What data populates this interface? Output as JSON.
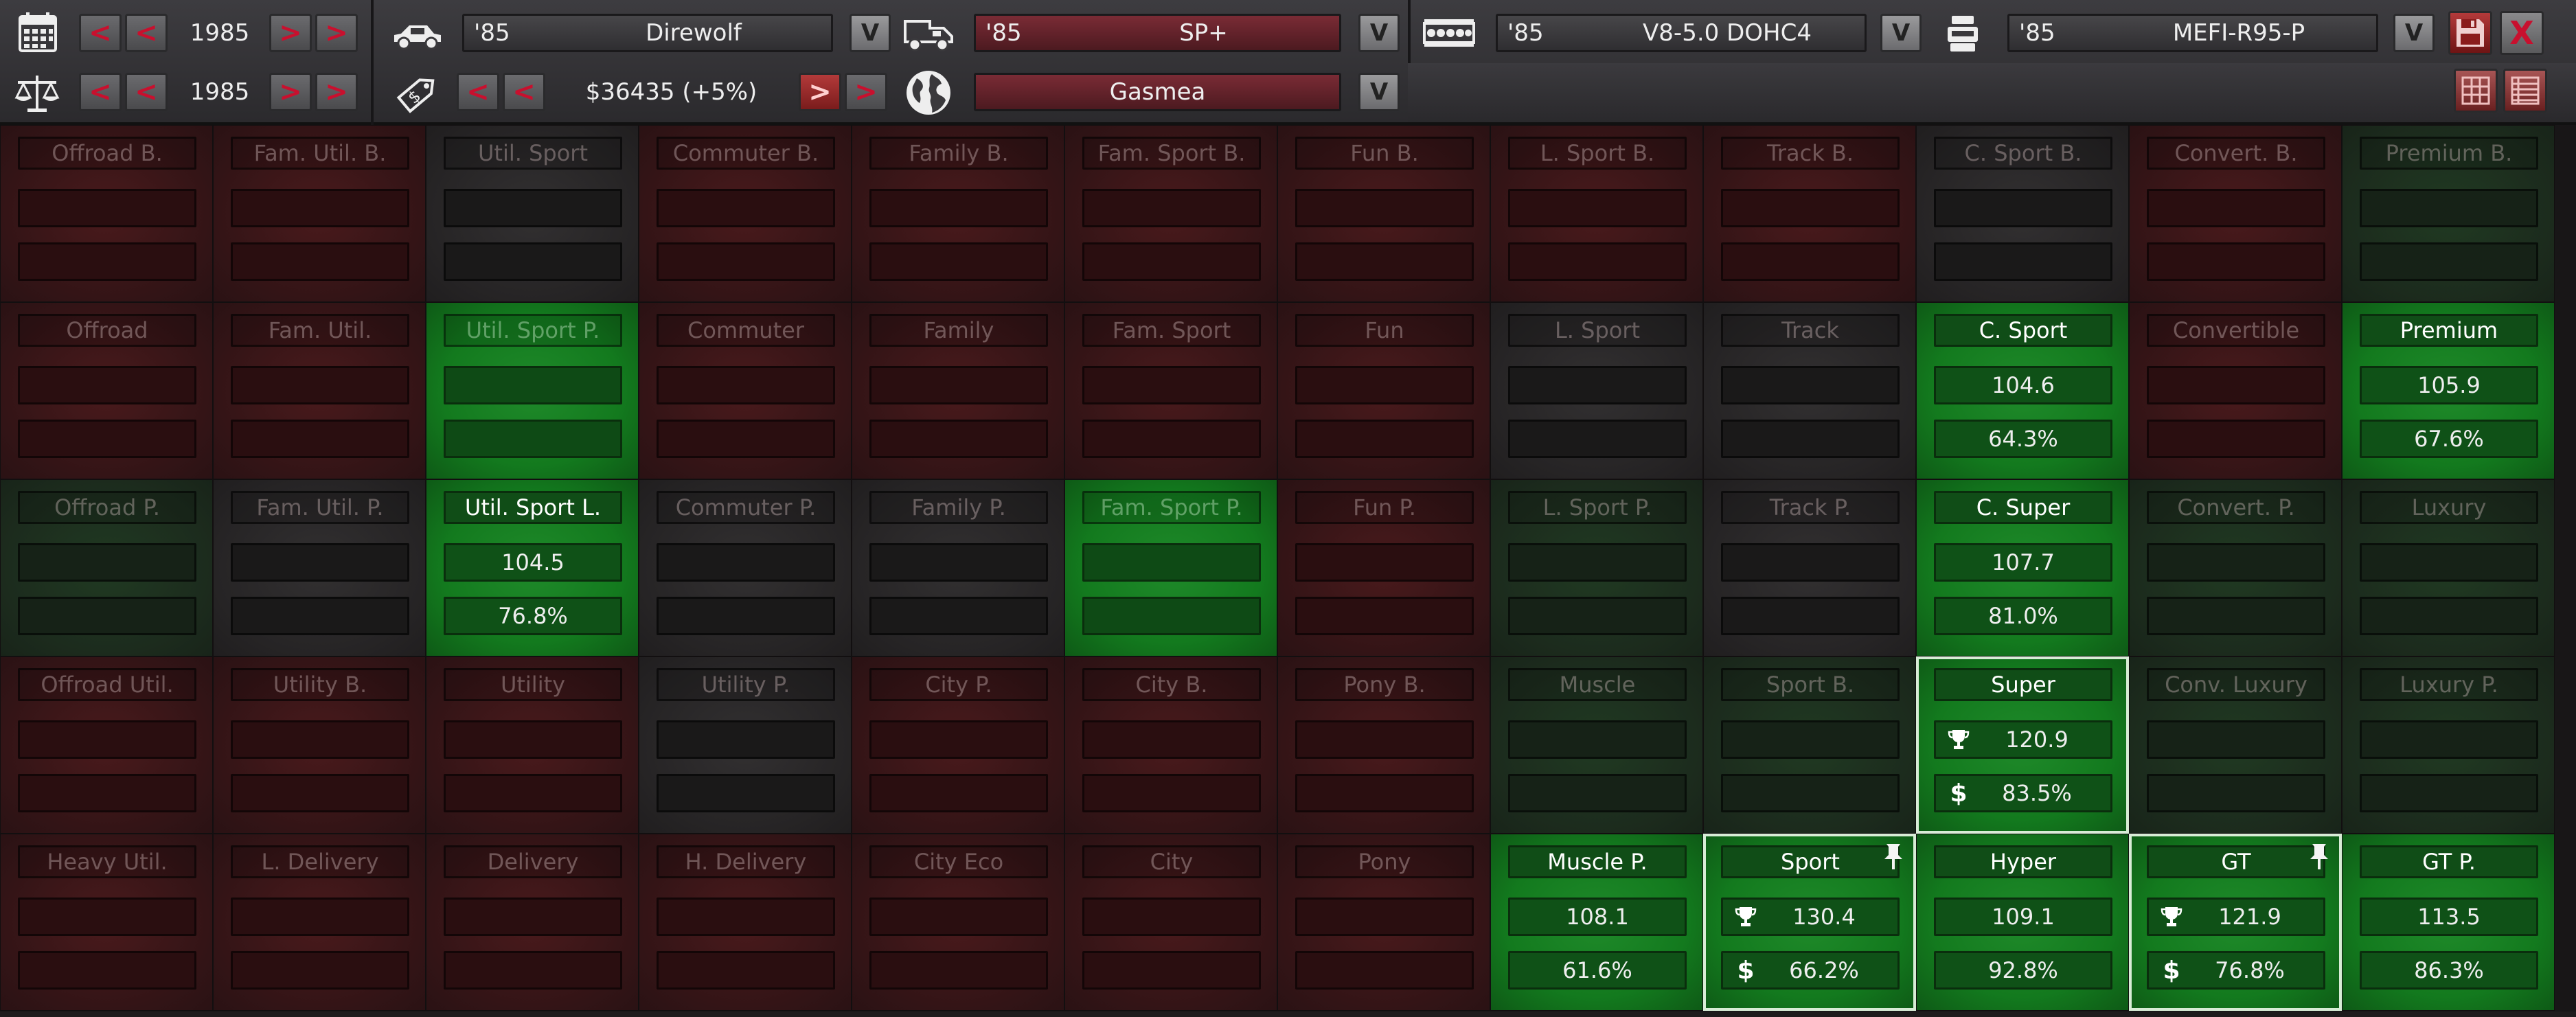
{
  "toolbar": {
    "year_select_1": {
      "value": "1985"
    },
    "year_select_2": {
      "value": "1985"
    },
    "model": {
      "year": "'85",
      "name": "Direwolf"
    },
    "trim": {
      "year": "'85",
      "name": "SP+"
    },
    "engine": {
      "year": "'85",
      "name": "V8-5.0 DOHC4"
    },
    "fuel_system": {
      "year": "'85",
      "name": "MEFI-R95-P"
    },
    "price": {
      "value": "$36435 (+5%)"
    },
    "market": {
      "value": "Gasmea"
    },
    "dropdown_glyph": "V",
    "prev_glyph": "<",
    "next_glyph": ">",
    "close_glyph": "X",
    "icons": [
      "calendar-icon",
      "balance-scale-icon",
      "car-icon",
      "price-tag-icon",
      "truck-icon",
      "globe-icon",
      "engine-block-icon",
      "fuel-system-icon",
      "save-disk-icon",
      "grid-view-icon",
      "list-view-icon"
    ],
    "colors": {
      "accent_red": "#c8102e",
      "trim_field": "#7a2b35"
    }
  },
  "legend": {
    "trophy_icon": "trophy-icon",
    "dollar_icon": "dollar-icon",
    "pin_icon": "pin-icon",
    "trophy_glyph": "🏆",
    "dollar_glyph": "$"
  },
  "colors": {
    "red_cell": "#3f1719",
    "gray_cell": "#2b292a",
    "dark_green_cell": "#1e2f1f",
    "green_cell": "#188a25",
    "selected_outline": "#d8ecd6"
  },
  "grid": {
    "rows": [
      [
        {
          "label": "Offroad B.",
          "tone": "red",
          "v1": "",
          "v2": "",
          "icons": false,
          "pinned": false,
          "selected": false,
          "faint": false
        },
        {
          "label": "Fam. Util. B.",
          "tone": "red",
          "v1": "",
          "v2": "",
          "icons": false,
          "pinned": false,
          "selected": false,
          "faint": false
        },
        {
          "label": "Util. Sport",
          "tone": "gray",
          "v1": "",
          "v2": "",
          "icons": false,
          "pinned": false,
          "selected": false,
          "faint": false
        },
        {
          "label": "Commuter B.",
          "tone": "red",
          "v1": "",
          "v2": "",
          "icons": false,
          "pinned": false,
          "selected": false,
          "faint": false
        },
        {
          "label": "Family B.",
          "tone": "red",
          "v1": "",
          "v2": "",
          "icons": false,
          "pinned": false,
          "selected": false,
          "faint": false
        },
        {
          "label": "Fam. Sport B.",
          "tone": "red",
          "v1": "",
          "v2": "",
          "icons": false,
          "pinned": false,
          "selected": false,
          "faint": false
        },
        {
          "label": "Fun B.",
          "tone": "red",
          "v1": "",
          "v2": "",
          "icons": false,
          "pinned": false,
          "selected": false,
          "faint": false
        },
        {
          "label": "L. Sport B.",
          "tone": "red",
          "v1": "",
          "v2": "",
          "icons": false,
          "pinned": false,
          "selected": false,
          "faint": false
        },
        {
          "label": "Track B.",
          "tone": "red",
          "v1": "",
          "v2": "",
          "icons": false,
          "pinned": false,
          "selected": false,
          "faint": false
        },
        {
          "label": "C. Sport B.",
          "tone": "gray",
          "v1": "",
          "v2": "",
          "icons": false,
          "pinned": false,
          "selected": false,
          "faint": false
        },
        {
          "label": "Convert. B.",
          "tone": "red",
          "v1": "",
          "v2": "",
          "icons": false,
          "pinned": false,
          "selected": false,
          "faint": false
        },
        {
          "label": "Premium B.",
          "tone": "dgreen",
          "v1": "",
          "v2": "",
          "icons": false,
          "pinned": false,
          "selected": false,
          "faint": false
        }
      ],
      [
        {
          "label": "Offroad",
          "tone": "red",
          "v1": "",
          "v2": "",
          "icons": false,
          "pinned": false,
          "selected": false,
          "faint": false
        },
        {
          "label": "Fam. Util.",
          "tone": "red",
          "v1": "",
          "v2": "",
          "icons": false,
          "pinned": false,
          "selected": false,
          "faint": false
        },
        {
          "label": "Util. Sport P.",
          "tone": "green",
          "v1": "",
          "v2": "",
          "icons": false,
          "pinned": false,
          "selected": false,
          "faint": true
        },
        {
          "label": "Commuter",
          "tone": "red",
          "v1": "",
          "v2": "",
          "icons": false,
          "pinned": false,
          "selected": false,
          "faint": false
        },
        {
          "label": "Family",
          "tone": "red",
          "v1": "",
          "v2": "",
          "icons": false,
          "pinned": false,
          "selected": false,
          "faint": false
        },
        {
          "label": "Fam. Sport",
          "tone": "red",
          "v1": "",
          "v2": "",
          "icons": false,
          "pinned": false,
          "selected": false,
          "faint": false
        },
        {
          "label": "Fun",
          "tone": "red",
          "v1": "",
          "v2": "",
          "icons": false,
          "pinned": false,
          "selected": false,
          "faint": false
        },
        {
          "label": "L. Sport",
          "tone": "gray",
          "v1": "",
          "v2": "",
          "icons": false,
          "pinned": false,
          "selected": false,
          "faint": false
        },
        {
          "label": "Track",
          "tone": "gray",
          "v1": "",
          "v2": "",
          "icons": false,
          "pinned": false,
          "selected": false,
          "faint": false
        },
        {
          "label": "C. Sport",
          "tone": "green",
          "v1": "104.6",
          "v2": "64.3%",
          "icons": false,
          "pinned": false,
          "selected": false,
          "faint": false
        },
        {
          "label": "Convertible",
          "tone": "red",
          "v1": "",
          "v2": "",
          "icons": false,
          "pinned": false,
          "selected": false,
          "faint": false
        },
        {
          "label": "Premium",
          "tone": "green",
          "v1": "105.9",
          "v2": "67.6%",
          "icons": false,
          "pinned": false,
          "selected": false,
          "faint": false
        }
      ],
      [
        {
          "label": "Offroad P.",
          "tone": "dgreen",
          "v1": "",
          "v2": "",
          "icons": false,
          "pinned": false,
          "selected": false,
          "faint": false
        },
        {
          "label": "Fam. Util. P.",
          "tone": "gray",
          "v1": "",
          "v2": "",
          "icons": false,
          "pinned": false,
          "selected": false,
          "faint": false
        },
        {
          "label": "Util. Sport L.",
          "tone": "green",
          "v1": "104.5",
          "v2": "76.8%",
          "icons": false,
          "pinned": false,
          "selected": false,
          "faint": false
        },
        {
          "label": "Commuter P.",
          "tone": "gray",
          "v1": "",
          "v2": "",
          "icons": false,
          "pinned": false,
          "selected": false,
          "faint": false
        },
        {
          "label": "Family P.",
          "tone": "gray",
          "v1": "",
          "v2": "",
          "icons": false,
          "pinned": false,
          "selected": false,
          "faint": false
        },
        {
          "label": "Fam. Sport P.",
          "tone": "green",
          "v1": "",
          "v2": "",
          "icons": false,
          "pinned": false,
          "selected": false,
          "faint": true
        },
        {
          "label": "Fun P.",
          "tone": "red",
          "v1": "",
          "v2": "",
          "icons": false,
          "pinned": false,
          "selected": false,
          "faint": false
        },
        {
          "label": "L. Sport P.",
          "tone": "dgreen",
          "v1": "",
          "v2": "",
          "icons": false,
          "pinned": false,
          "selected": false,
          "faint": false
        },
        {
          "label": "Track P.",
          "tone": "gray",
          "v1": "",
          "v2": "",
          "icons": false,
          "pinned": false,
          "selected": false,
          "faint": false
        },
        {
          "label": "C. Super",
          "tone": "green",
          "v1": "107.7",
          "v2": "81.0%",
          "icons": false,
          "pinned": false,
          "selected": false,
          "faint": false
        },
        {
          "label": "Convert. P.",
          "tone": "dgreen",
          "v1": "",
          "v2": "",
          "icons": false,
          "pinned": false,
          "selected": false,
          "faint": false
        },
        {
          "label": "Luxury",
          "tone": "dgreen",
          "v1": "",
          "v2": "",
          "icons": false,
          "pinned": false,
          "selected": false,
          "faint": false
        }
      ],
      [
        {
          "label": "Offroad Util.",
          "tone": "red",
          "v1": "",
          "v2": "",
          "icons": false,
          "pinned": false,
          "selected": false,
          "faint": false
        },
        {
          "label": "Utility B.",
          "tone": "red",
          "v1": "",
          "v2": "",
          "icons": false,
          "pinned": false,
          "selected": false,
          "faint": false
        },
        {
          "label": "Utility",
          "tone": "red",
          "v1": "",
          "v2": "",
          "icons": false,
          "pinned": false,
          "selected": false,
          "faint": false
        },
        {
          "label": "Utility P.",
          "tone": "gray",
          "v1": "",
          "v2": "",
          "icons": false,
          "pinned": false,
          "selected": false,
          "faint": false
        },
        {
          "label": "City P.",
          "tone": "red",
          "v1": "",
          "v2": "",
          "icons": false,
          "pinned": false,
          "selected": false,
          "faint": false
        },
        {
          "label": "City B.",
          "tone": "red",
          "v1": "",
          "v2": "",
          "icons": false,
          "pinned": false,
          "selected": false,
          "faint": false
        },
        {
          "label": "Pony B.",
          "tone": "red",
          "v1": "",
          "v2": "",
          "icons": false,
          "pinned": false,
          "selected": false,
          "faint": false
        },
        {
          "label": "Muscle",
          "tone": "dgreen",
          "v1": "",
          "v2": "",
          "icons": false,
          "pinned": false,
          "selected": false,
          "faint": false
        },
        {
          "label": "Sport B.",
          "tone": "dgreen",
          "v1": "",
          "v2": "",
          "icons": false,
          "pinned": false,
          "selected": false,
          "faint": false
        },
        {
          "label": "Super",
          "tone": "green",
          "v1": "120.9",
          "v2": "83.5%",
          "icons": true,
          "pinned": false,
          "selected": true,
          "faint": false
        },
        {
          "label": "Conv. Luxury",
          "tone": "dgreen",
          "v1": "",
          "v2": "",
          "icons": false,
          "pinned": false,
          "selected": false,
          "faint": false
        },
        {
          "label": "Luxury P.",
          "tone": "dgreen",
          "v1": "",
          "v2": "",
          "icons": false,
          "pinned": false,
          "selected": false,
          "faint": false
        }
      ],
      [
        {
          "label": "Heavy Util.",
          "tone": "red",
          "v1": "",
          "v2": "",
          "icons": false,
          "pinned": false,
          "selected": false,
          "faint": false
        },
        {
          "label": "L. Delivery",
          "tone": "red",
          "v1": "",
          "v2": "",
          "icons": false,
          "pinned": false,
          "selected": false,
          "faint": false
        },
        {
          "label": "Delivery",
          "tone": "red",
          "v1": "",
          "v2": "",
          "icons": false,
          "pinned": false,
          "selected": false,
          "faint": false
        },
        {
          "label": "H. Delivery",
          "tone": "red",
          "v1": "",
          "v2": "",
          "icons": false,
          "pinned": false,
          "selected": false,
          "faint": false
        },
        {
          "label": "City Eco",
          "tone": "red",
          "v1": "",
          "v2": "",
          "icons": false,
          "pinned": false,
          "selected": false,
          "faint": false
        },
        {
          "label": "City",
          "tone": "red",
          "v1": "",
          "v2": "",
          "icons": false,
          "pinned": false,
          "selected": false,
          "faint": false
        },
        {
          "label": "Pony",
          "tone": "red",
          "v1": "",
          "v2": "",
          "icons": false,
          "pinned": false,
          "selected": false,
          "faint": false
        },
        {
          "label": "Muscle P.",
          "tone": "green",
          "v1": "108.1",
          "v2": "61.6%",
          "icons": false,
          "pinned": false,
          "selected": false,
          "faint": false
        },
        {
          "label": "Sport",
          "tone": "green",
          "v1": "130.4",
          "v2": "66.2%",
          "icons": true,
          "pinned": true,
          "selected": true,
          "faint": false
        },
        {
          "label": "Hyper",
          "tone": "green",
          "v1": "109.1",
          "v2": "92.8%",
          "icons": false,
          "pinned": false,
          "selected": false,
          "faint": false
        },
        {
          "label": "GT",
          "tone": "green",
          "v1": "121.9",
          "v2": "76.8%",
          "icons": true,
          "pinned": true,
          "selected": true,
          "faint": false
        },
        {
          "label": "GT P.",
          "tone": "green",
          "v1": "113.5",
          "v2": "86.3%",
          "icons": false,
          "pinned": false,
          "selected": false,
          "faint": false
        }
      ]
    ]
  }
}
